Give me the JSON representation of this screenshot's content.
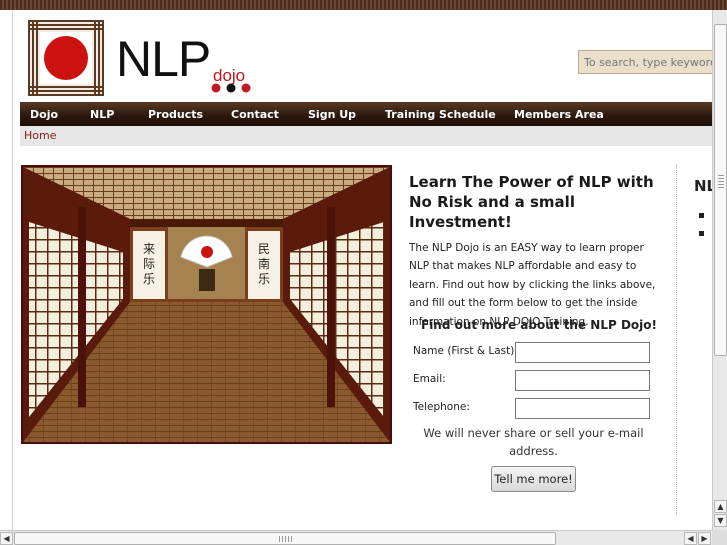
{
  "header": {
    "logo_text": "NLP",
    "logo_sub": "dojo",
    "search_placeholder": "To search, type keywords"
  },
  "nav": {
    "items": [
      "Dojo",
      "NLP",
      "Products",
      "Contact",
      "Sign Up",
      "Training Schedule",
      "Members Area"
    ]
  },
  "breadcrumb": {
    "home": "Home"
  },
  "main": {
    "headline": "Learn The Power of NLP with No Risk and a small Investment!",
    "intro": "The NLP Dojo is an EASY way to learn proper NLP that makes NLP affordable and easy to learn. Find out how by clicking the links above, and fill out the form below to get the inside information on NLP DOJO Training.",
    "form": {
      "title": "Find out more about the NLP Dojo!",
      "name_label": "Name (First & Last):",
      "email_label": "Email:",
      "phone_label": "Telephone:",
      "name_value": "",
      "email_value": "",
      "phone_value": "",
      "privacy": "We will never share or sell your e-mail address.",
      "submit_label": "Tell me more!"
    },
    "image": {
      "scroll_left": "来际乐",
      "scroll_right": "民南乐"
    }
  },
  "sidebar": {
    "title": "NL"
  },
  "colors": {
    "nav_bg": "#2e1a0e",
    "accent_red": "#c0191f",
    "search_bg": "#e9dfcb"
  }
}
